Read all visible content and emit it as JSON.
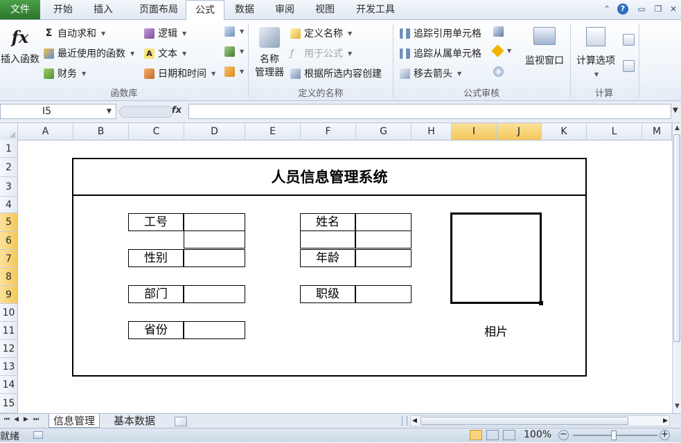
{
  "ribbon_tabs": {
    "file": "文件",
    "home": "开始",
    "insert": "插入",
    "page_layout": "页面布局",
    "formulas": "公式",
    "data": "数据",
    "review": "审阅",
    "view": "视图",
    "developer": "开发工具"
  },
  "function_library": {
    "insert_function": "插入函数",
    "autosum": "自动求和",
    "recently_used": "最近使用的函数",
    "financial": "财务",
    "logical": "逻辑",
    "text": "文本",
    "date_time": "日期和时间",
    "group_label": "函数库"
  },
  "defined_names": {
    "name_manager_line1": "名称",
    "name_manager_line2": "管理器",
    "define_name": "定义名称",
    "use_in_formula": "用于公式",
    "create_from_selection": "根据所选内容创建",
    "group_label": "定义的名称"
  },
  "formula_auditing": {
    "trace_precedents": "追踪引用单元格",
    "trace_dependents": "追踪从属单元格",
    "remove_arrows": "移去箭头",
    "watch_window": "监视窗口",
    "group_label": "公式审核"
  },
  "calculation": {
    "calc_options": "计算选项",
    "group_label": "计算"
  },
  "formula_bar": {
    "name_box": "I5",
    "fx": "fx",
    "formula": ""
  },
  "grid": {
    "columns": [
      "A",
      "B",
      "C",
      "D",
      "E",
      "F",
      "G",
      "H",
      "I",
      "J",
      "K",
      "L",
      "M"
    ],
    "rows": [
      "1",
      "2",
      "3",
      "4",
      "5",
      "6",
      "7",
      "8",
      "9",
      "10",
      "11",
      "12",
      "13",
      "14",
      "15"
    ]
  },
  "form": {
    "title": "人员信息管理系统",
    "employee_id": "工号",
    "name": "姓名",
    "gender": "性别",
    "age": "年龄",
    "department": "部门",
    "rank": "职级",
    "province": "省份",
    "photo": "相片"
  },
  "sheets": {
    "tab1": "信息管理",
    "tab2": "基本数据"
  },
  "status": {
    "ready": "就绪",
    "zoom": "100%"
  }
}
